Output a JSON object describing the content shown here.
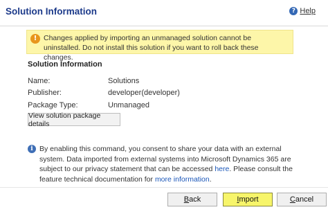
{
  "header": {
    "title": "Solution Information",
    "help_label": "Help"
  },
  "warning": {
    "text": "Changes applied by importing an unmanaged solution cannot be uninstalled. Do not install this solution if you want to roll back these changes."
  },
  "section": {
    "title": "Solution Information",
    "rows": [
      {
        "label": "Name:",
        "value": "Solutions"
      },
      {
        "label": "Publisher:",
        "value": "developer(developer)"
      },
      {
        "label": "Package Type:",
        "value": "Unmanaged"
      }
    ],
    "package_button": "View solution package details"
  },
  "consent": {
    "text_1": "By enabling this command, you consent to share your data with an external system. Data imported from external systems into Microsoft Dynamics 365 are subject to our privacy statement that can be accessed ",
    "link_here": "here",
    "text_2": ". Please consult the feature technical documentation for ",
    "link_more": "more information",
    "text_3": "."
  },
  "footer": {
    "back": {
      "first": "B",
      "rest": "ack"
    },
    "import": {
      "first": "I",
      "rest": "mport"
    },
    "cancel": {
      "first": "C",
      "rest": "ancel"
    }
  },
  "colors": {
    "title": "#1c3a8a",
    "warning_bg": "#fdf6a9",
    "link": "#1a56b8",
    "import_highlight": "#f7f56a"
  }
}
